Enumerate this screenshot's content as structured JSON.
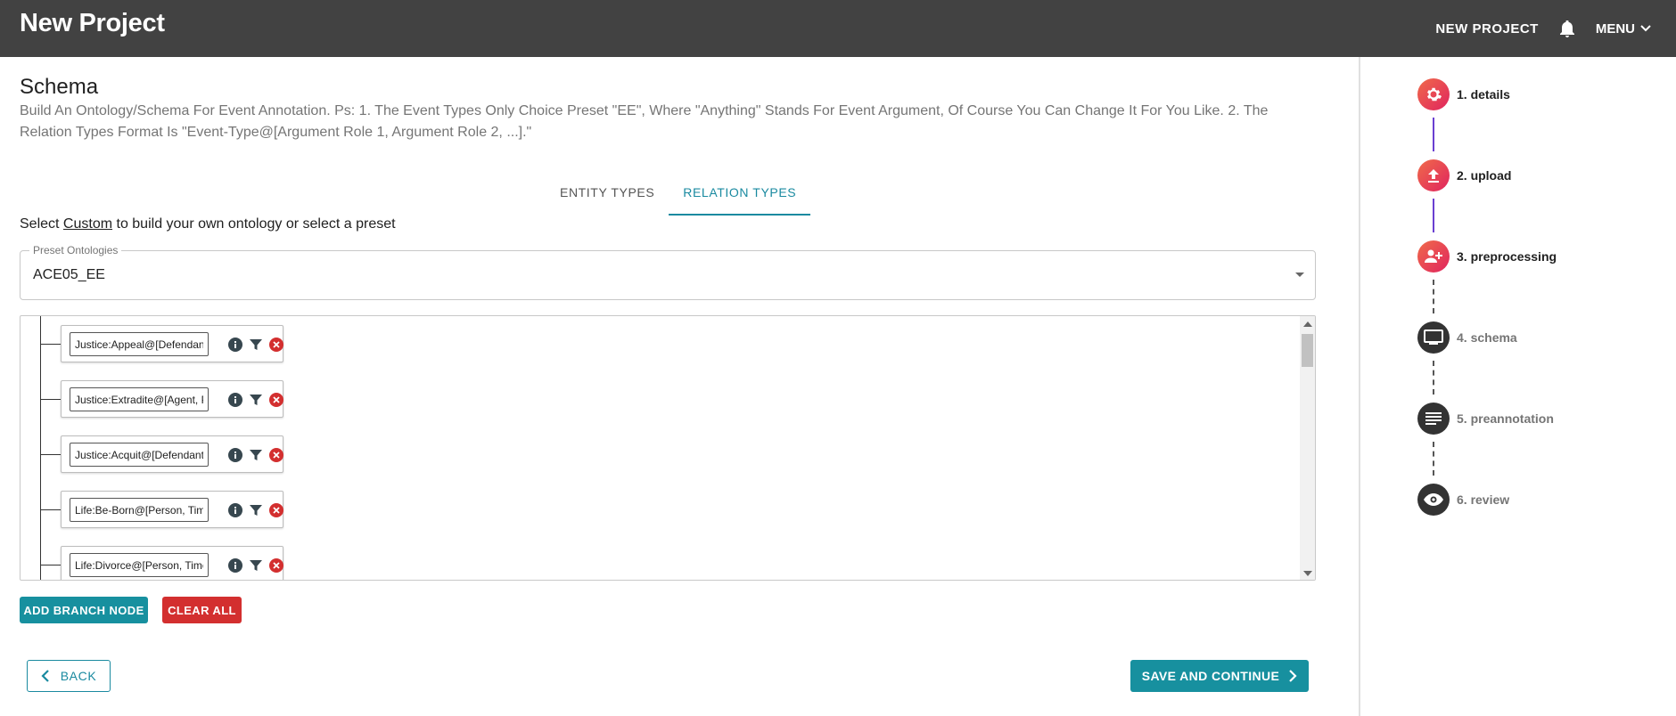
{
  "header": {
    "title": "New Project",
    "new_project_label": "NEW PROJECT",
    "menu_label": "MENU"
  },
  "schema": {
    "title": "Schema",
    "description": "Build An Ontology/Schema For Event Annotation. Ps: 1. The Event Types Only Choice Preset \"EE\", Where \"Anything\" Stands For Event Argument, Of Course You Can Change It For You Like. 2. The Relation Types Format Is \"Event-Type@[Argument Role 1, Argument Role 2, ...].\"",
    "tabs": [
      {
        "label": "ENTITY TYPES",
        "active": false
      },
      {
        "label": "RELATION TYPES",
        "active": true
      }
    ],
    "hint_prefix": "Select ",
    "hint_link": "Custom",
    "hint_suffix": " to build your own ontology or select a preset",
    "preset_label": "Preset Ontologies",
    "preset_value": "ACE05_EE",
    "nodes": [
      {
        "value": "Justice:Appeal@[Defendant, Adjudicator, Crime, Time, Place]"
      },
      {
        "value": "Justice:Extradite@[Agent, Person, Destination, Origin, Crime, Time]"
      },
      {
        "value": "Justice:Acquit@[Defendant, Adjudicator, Crime, Time, Place]"
      },
      {
        "value": "Life:Be-Born@[Person, Time, Place]"
      },
      {
        "value": "Life:Divorce@[Person, Time, Place]"
      }
    ],
    "add_branch_label": "ADD BRANCH NODE",
    "clear_all_label": "CLEAR ALL"
  },
  "footer": {
    "back_label": "BACK",
    "save_label": "SAVE AND CONTINUE"
  },
  "stepper": {
    "steps": [
      {
        "label": "1. details",
        "status": "done",
        "icon": "gear-icon"
      },
      {
        "label": "2. upload",
        "status": "done",
        "icon": "upload-icon"
      },
      {
        "label": "3. preprocessing",
        "status": "done",
        "icon": "person-add-icon"
      },
      {
        "label": "4. schema",
        "status": "todo",
        "icon": "monitor-icon"
      },
      {
        "label": "5. preannotation",
        "status": "todo",
        "icon": "lines-icon"
      },
      {
        "label": "6. review",
        "status": "todo",
        "icon": "eye-icon"
      }
    ]
  },
  "colors": {
    "topbar": "#424242",
    "accent": "#17909f",
    "danger": "#d32f2f",
    "step_done_start": "#f06b4a",
    "step_done_end": "#e0245e",
    "step_line_done": "#6a3fd1"
  }
}
